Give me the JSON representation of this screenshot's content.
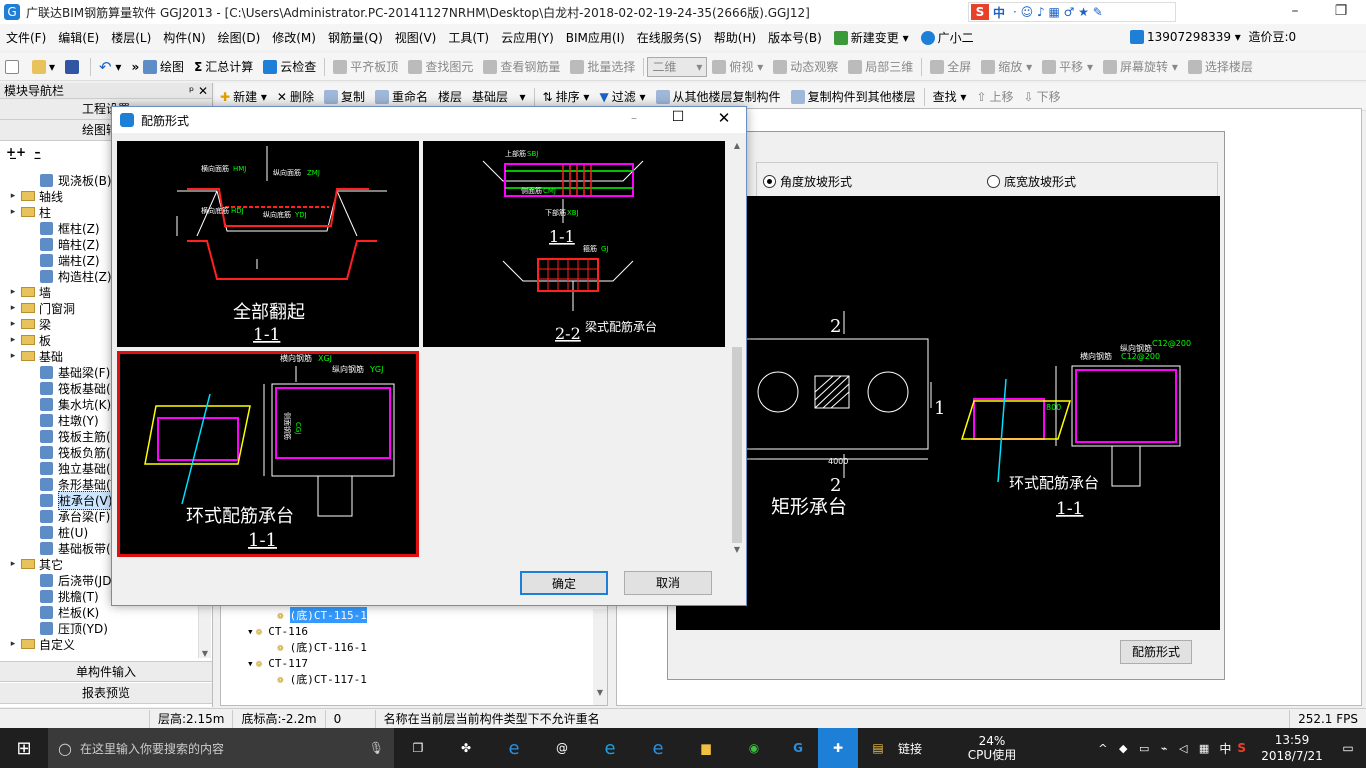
{
  "window": {
    "title": "广联达BIM钢筋算量软件 GGJ2013 - [C:\\Users\\Administrator.PC-20141127NRHM\\Desktop\\白龙村-2018-02-02-19-24-35(2666版).GGJ12]",
    "ime": "中"
  },
  "menu": [
    "文件(F)",
    "编辑(E)",
    "楼层(L)",
    "构件(N)",
    "绘图(D)",
    "修改(M)",
    "钢筋量(Q)",
    "视图(V)",
    "工具(T)",
    "云应用(Y)",
    "BIM应用(I)",
    "在线服务(S)",
    "帮助(H)",
    "版本号(B)",
    "新建变更",
    "广小二"
  ],
  "account": {
    "phone": "13907298339",
    "coins": "造价豆:0"
  },
  "toolbar1": {
    "draw": "绘图",
    "sum": "汇总计算",
    "cloud_check": "云检查",
    "flat_top": "平齐板顶",
    "find_elem": "查找图元",
    "view_rebar": "查看钢筋量",
    "batch_select": "批量选择",
    "view_mode": "二维",
    "top_view": "俯视",
    "dynamic_view": "动态观察",
    "local_3d": "局部三维",
    "fullscreen": "全屏",
    "zoom": "缩放",
    "pan": "平移",
    "rotate": "屏幕旋转",
    "select_floor": "选择楼层"
  },
  "toolbar2": {
    "new": "新建",
    "delete": "删除",
    "copy": "复制",
    "rename": "重命名",
    "floor": "楼层",
    "floor_value": "基础层",
    "sort": "排序",
    "filter": "过滤",
    "copy_from": "从其他楼层复制构件",
    "copy_to": "复制构件到其他楼层",
    "find": "查找",
    "move_up": "上移",
    "move_down": "下移"
  },
  "left_panel": {
    "header": "模块导航栏",
    "btn_project": "工程设置",
    "btn_draw": "绘图输入",
    "tree": [
      {
        "label": "现浇板(B)",
        "indent": 2,
        "type": "item"
      },
      {
        "label": "轴线",
        "indent": 1,
        "type": "folder"
      },
      {
        "label": "柱",
        "indent": 1,
        "type": "folder"
      },
      {
        "label": "框柱(Z)",
        "indent": 2,
        "type": "item"
      },
      {
        "label": "暗柱(Z)",
        "indent": 2,
        "type": "item"
      },
      {
        "label": "端柱(Z)",
        "indent": 2,
        "type": "item"
      },
      {
        "label": "构造柱(Z)",
        "indent": 2,
        "type": "item"
      },
      {
        "label": "墙",
        "indent": 1,
        "type": "folder"
      },
      {
        "label": "门窗洞",
        "indent": 1,
        "type": "folder"
      },
      {
        "label": "梁",
        "indent": 1,
        "type": "folder"
      },
      {
        "label": "板",
        "indent": 1,
        "type": "folder"
      },
      {
        "label": "基础",
        "indent": 1,
        "type": "folder"
      },
      {
        "label": "基础梁(F)",
        "indent": 2,
        "type": "item"
      },
      {
        "label": "筏板基础(M)",
        "indent": 2,
        "type": "item"
      },
      {
        "label": "集水坑(K)",
        "indent": 2,
        "type": "item"
      },
      {
        "label": "柱墩(Y)",
        "indent": 2,
        "type": "item"
      },
      {
        "label": "筏板主筋(R)",
        "indent": 2,
        "type": "item"
      },
      {
        "label": "筏板负筋(X)",
        "indent": 2,
        "type": "item"
      },
      {
        "label": "独立基础(D)",
        "indent": 2,
        "type": "item"
      },
      {
        "label": "条形基础(T)",
        "indent": 2,
        "type": "item"
      },
      {
        "label": "桩承台(V)",
        "indent": 2,
        "type": "item",
        "selected": true
      },
      {
        "label": "承台梁(F)",
        "indent": 2,
        "type": "item"
      },
      {
        "label": "桩(U)",
        "indent": 2,
        "type": "item"
      },
      {
        "label": "基础板带(W)",
        "indent": 2,
        "type": "item"
      },
      {
        "label": "其它",
        "indent": 1,
        "type": "folder"
      },
      {
        "label": "后浇带(JD)",
        "indent": 2,
        "type": "item"
      },
      {
        "label": "挑檐(T)",
        "indent": 2,
        "type": "item"
      },
      {
        "label": "栏板(K)",
        "indent": 2,
        "type": "item"
      },
      {
        "label": "压顶(YD)",
        "indent": 2,
        "type": "item"
      },
      {
        "label": "自定义",
        "indent": 1,
        "type": "folder"
      }
    ],
    "btn_input": "单构件输入",
    "btn_report": "报表预览"
  },
  "component_list": [
    {
      "label": "(底)CT-115-1",
      "indent": 2,
      "selected": true
    },
    {
      "label": "CT-116",
      "indent": 1
    },
    {
      "label": "(底)CT-116-1",
      "indent": 2
    },
    {
      "label": "CT-117",
      "indent": 1
    },
    {
      "label": "(底)CT-117-1",
      "indent": 2
    }
  ],
  "right_panel": {
    "radio_angle": "角度放坡形式",
    "radio_width": "底宽放坡形式",
    "rect_caption": "矩形承台",
    "ring_caption": "环式配筋承台",
    "section": "1-1",
    "dim_2": "2",
    "dim_1": "1",
    "dim_4000": "4000",
    "dim_800": "800",
    "lbl_h": "横向钢筋",
    "lbl_v": "纵向钢筋",
    "rebar_spec": "C12@200",
    "side_rebar": "侧面钢筋",
    "btn_form": "配筋形式"
  },
  "dialog": {
    "title": "配筋形式",
    "options": [
      {
        "caption": "全部翻起",
        "section": "1-1",
        "labels": [
          "横向面筋",
          "纵向面筋",
          "横向底筋",
          "纵向底筋"
        ],
        "codes": [
          "HMJ",
          "ZMJ",
          "HDJ",
          "YDJ"
        ]
      },
      {
        "caption": "梁式配筋承台",
        "section1": "1-1",
        "section2": "2-2",
        "labels": [
          "上部筋",
          "下部筋",
          "侧面筋",
          "箍筋"
        ],
        "codes": [
          "SBJ",
          "XBJ",
          "CMJ",
          "GJ"
        ]
      },
      {
        "caption": "环式配筋承台",
        "section": "1-1",
        "labels": [
          "横向钢筋",
          "纵向钢筋",
          "侧面钢筋"
        ],
        "codes": [
          "XGJ",
          "YGJ",
          "CGJ"
        ],
        "selected": true
      }
    ],
    "ok": "确定",
    "cancel": "取消"
  },
  "status": {
    "floor_height": "层高:2.15m",
    "bottom_elev": "底标高:-2.2m",
    "count": "0",
    "message": "名称在当前层当前构件类型下不允许重名",
    "fps": "252.1 FPS"
  },
  "taskbar": {
    "search_placeholder": "在这里输入你要搜索的内容",
    "link": "链接",
    "cpu_pct": "24%",
    "cpu_label": "CPU使用",
    "ime": "中",
    "time": "13:59",
    "date": "2018/7/21"
  },
  "colors": {
    "accent": "#1e7fd6",
    "selected_border": "#e01010",
    "cad_bg": "#000000",
    "magenta": "#ff00ff",
    "yellow": "#ffff00",
    "cyan": "#00e0ff",
    "green": "#00ff00",
    "red": "#ff2020"
  }
}
